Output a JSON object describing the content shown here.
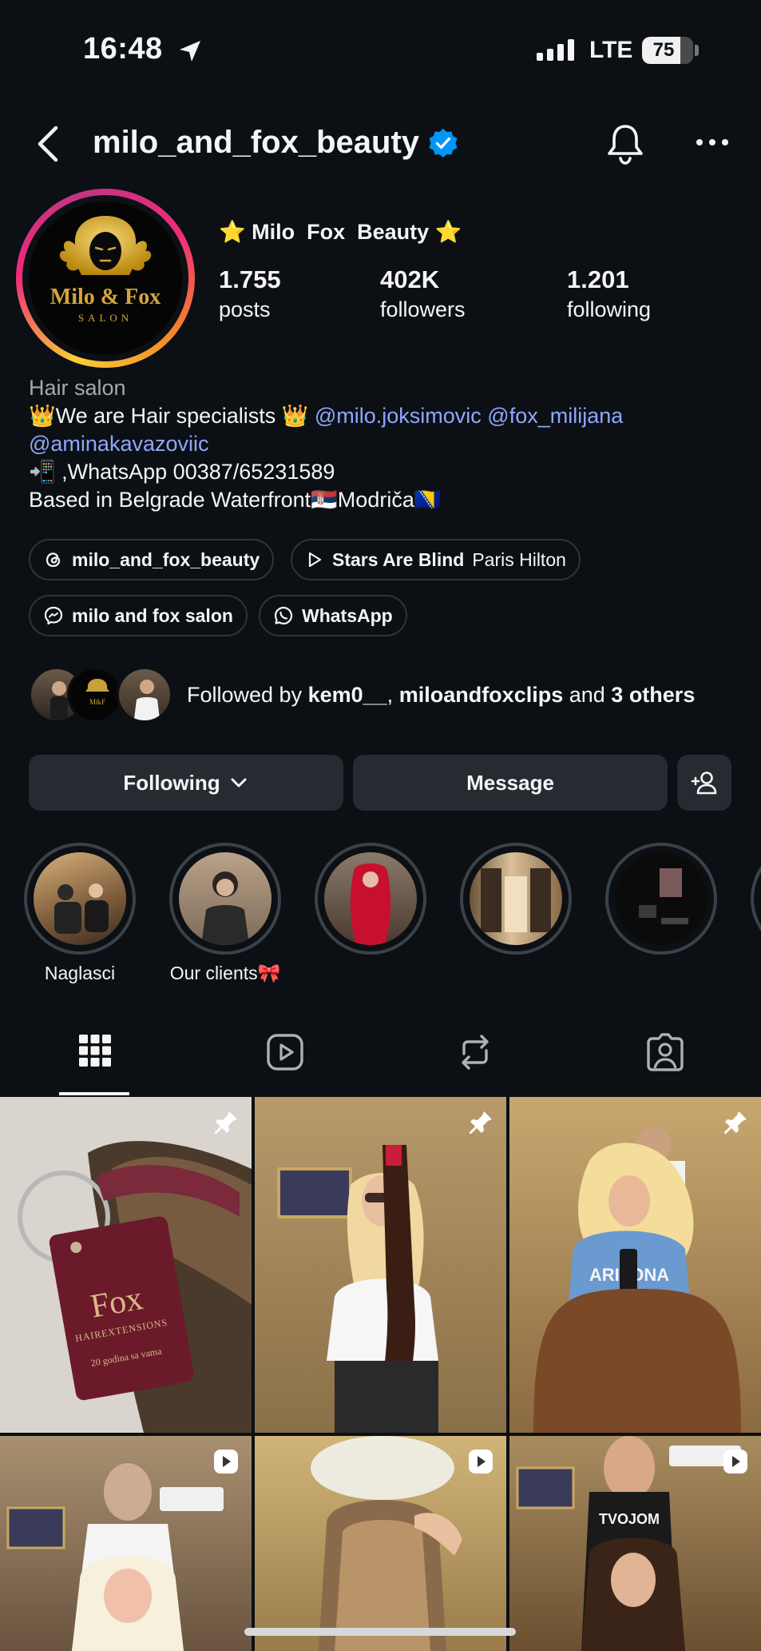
{
  "status_bar": {
    "time": "16:48",
    "network": "LTE",
    "battery": "75",
    "battery_level": 0.75
  },
  "header": {
    "username": "milo_and_fox_beauty",
    "verified": true
  },
  "profile": {
    "display_name": "⭐ Milo  Fox  Beauty ⭐",
    "avatar_text_top": "Milo & Fox",
    "avatar_text_bottom": "SALON",
    "stats": [
      {
        "value": "1.755",
        "label": "posts"
      },
      {
        "value": "402K",
        "label": "followers"
      },
      {
        "value": "1.201",
        "label": "following"
      }
    ],
    "category": "Hair salon",
    "bio_line1_prefix": "👑We are Hair specialists 👑 ",
    "bio_mention1": "@milo.joksimovic",
    "bio_mention2": "@fox_milijana",
    "bio_mention3": "@aminakavazoviic",
    "bio_line3": "📲 ,WhatsApp 00387/65231589",
    "bio_line4": "Based in Belgrade Waterfront🇷🇸Modriča🇧🇦"
  },
  "chips": [
    {
      "label": "milo_and_fox_beauty",
      "icon": "threads-icon"
    },
    {
      "label": "Stars Are Blind",
      "sub": "Paris Hilton",
      "icon": "play-icon"
    },
    {
      "label": "milo and fox salon",
      "icon": "messenger-icon"
    },
    {
      "label": "WhatsApp",
      "icon": "whatsapp-icon"
    }
  ],
  "followed_by": {
    "prefix": "Followed by ",
    "user1": "kem0__",
    "sep": ", ",
    "user2": "miloandfoxclips",
    "mid": " and ",
    "others": "3 others"
  },
  "buttons": {
    "following": "Following",
    "message": "Message"
  },
  "highlights": [
    {
      "label": "Naglasci"
    },
    {
      "label": "Our clients🎀"
    },
    {
      "label": ""
    },
    {
      "label": ""
    },
    {
      "label": ""
    }
  ],
  "tabs": [
    "grid-icon",
    "reels-icon",
    "reposts-icon",
    "tagged-icon"
  ],
  "posts": [
    {
      "type": "pinned",
      "text_main": "Fox",
      "text_sub": "HAIREXTENSIONS",
      "text_small": "20 godina sa vama"
    },
    {
      "type": "pinned"
    },
    {
      "type": "pinned",
      "shirt_text": "ARIZONA"
    },
    {
      "type": "reel"
    },
    {
      "type": "reel"
    },
    {
      "type": "reel",
      "shirt_text": "TVOJOM"
    }
  ],
  "colors": {
    "background": "#0c1014",
    "button": "#262b31",
    "link": "#8ea7ff",
    "verified": "#0095f6"
  }
}
